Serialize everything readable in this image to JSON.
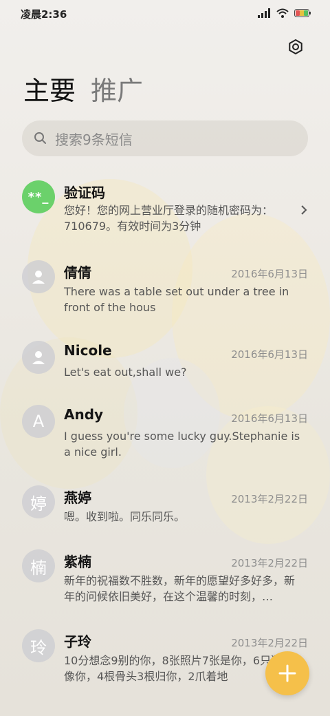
{
  "status_bar": {
    "time": "凌晨2:36"
  },
  "tabs": [
    {
      "label": "主要",
      "active": true
    },
    {
      "label": "推广",
      "active": false
    }
  ],
  "search": {
    "placeholder": "搜索9条短信"
  },
  "messages": [
    {
      "avatar": "**_",
      "avatar_type": "verification",
      "name": "验证码",
      "date": "",
      "preview": "您好！您的网上营业厅登录的随机密码为：710679。有效时间为3分钟"
    },
    {
      "avatar": "",
      "avatar_type": "person",
      "name": "倩倩",
      "date": "2016年6月13日",
      "preview": "There was a table set out under a tree in front of the hous"
    },
    {
      "avatar": "",
      "avatar_type": "person",
      "name": "Nicole",
      "date": "2016年6月13日",
      "preview": "Let's eat out,shall we?"
    },
    {
      "avatar": "A",
      "avatar_type": "letter",
      "name": "Andy",
      "date": "2016年6月13日",
      "preview": "I guess you're some lucky guy.Stephanie is a nice girl."
    },
    {
      "avatar": "婷",
      "avatar_type": "letter",
      "name": "燕婷",
      "date": "2013年2月22日",
      "preview": "嗯。收到啦。同乐同乐。"
    },
    {
      "avatar": "楠",
      "avatar_type": "letter",
      "name": "紫楠",
      "date": "2013年2月22日",
      "preview": "新年的祝福数不胜数，新年的愿望好多好多，新年的问候依旧美好，在这个温馨的时刻，…"
    },
    {
      "avatar": "玲",
      "avatar_type": "letter",
      "name": "子玲",
      "date": "2013年2月22日",
      "preview": "10分想念9别的你，8张照片7张是你，6只狗5只像你，4根骨头3根归你，2爪着地"
    }
  ],
  "colors": {
    "fab": "#f5c04a",
    "verification_avatar": "#6bd16b"
  },
  "icons": {
    "settings": "settings-icon",
    "search": "search-icon",
    "compose": "plus-icon",
    "chevron": "chevron-right-icon"
  }
}
